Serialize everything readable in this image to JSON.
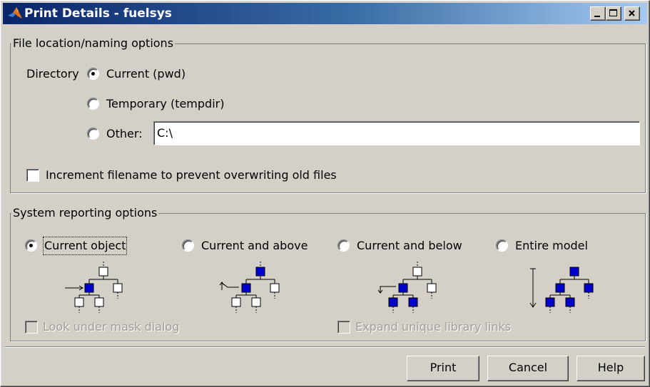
{
  "window": {
    "title": "Print Details - fuelsys"
  },
  "file_group": {
    "legend": "File location/naming options",
    "directory_label": "Directory",
    "options": [
      {
        "label": "Current (pwd)",
        "checked": true
      },
      {
        "label": "Temporary (tempdir)",
        "checked": false
      },
      {
        "label": "Other:",
        "checked": false
      }
    ],
    "other_value": "C:\\",
    "increment_label": "Increment filename to prevent overwriting old files",
    "increment_checked": false
  },
  "system_group": {
    "legend": "System reporting options",
    "options": [
      {
        "label": "Current object",
        "checked": true
      },
      {
        "label": "Current and above",
        "checked": false
      },
      {
        "label": "Current and below",
        "checked": false
      },
      {
        "label": "Entire model",
        "checked": false
      }
    ],
    "look_under_mask_label": "Look under mask dialog",
    "expand_links_label": "Expand unique library links"
  },
  "buttons": {
    "print": "Print",
    "cancel": "Cancel",
    "help": "Help"
  },
  "colors": {
    "selected_node": "#0000cc",
    "title_start": "#0a246a",
    "title_end": "#a6caf0"
  }
}
